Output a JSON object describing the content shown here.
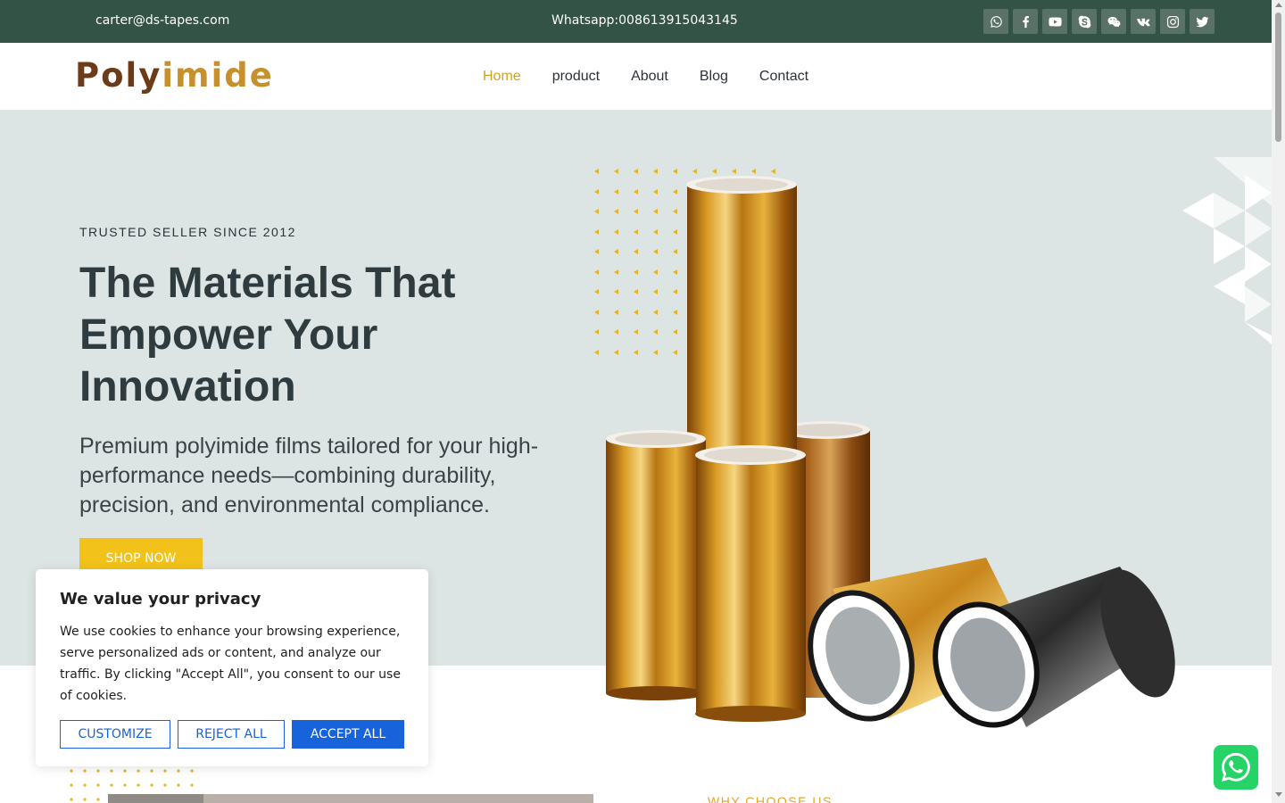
{
  "topbar": {
    "email": "carter@ds-tapes.com",
    "whatsapp": "Whatsapp:008613915043145",
    "socials": [
      {
        "icon": "whatsapp-icon"
      },
      {
        "icon": "facebook-icon"
      },
      {
        "icon": "youtube-icon"
      },
      {
        "icon": "skype-icon"
      },
      {
        "icon": "wechat-icon"
      },
      {
        "icon": "vk-icon"
      },
      {
        "icon": "instagram-icon"
      },
      {
        "icon": "twitter-icon"
      }
    ]
  },
  "header": {
    "logo_part1": "Poly",
    "logo_part2": "imide",
    "nav": [
      {
        "label": "Home",
        "active": true
      },
      {
        "label": "product"
      },
      {
        "label": "About"
      },
      {
        "label": "Blog"
      },
      {
        "label": "Contact"
      }
    ]
  },
  "hero": {
    "eyebrow": "TRUSTED SELLER SINCE 2012",
    "title": "The Materials That Empower Your Innovation",
    "subtitle": "Premium polyimide films tailored for your high-performance needs—combining durability, precision, and environmental compliance.",
    "cta": "SHOP NOW"
  },
  "cookie": {
    "title": "We value your privacy",
    "body": "We use cookies to enhance your browsing experience, serve personalized ads or content, and analyze our traffic. By clicking \"Accept All\", you consent to our use of cookies.",
    "customize": "CUSTOMIZE",
    "reject": "REJECT ALL",
    "accept": "ACCEPT ALL"
  },
  "lower": {
    "why": "WHY CHOOSE US"
  },
  "colors": {
    "topbar": "#345347",
    "accent": "#f2c21a",
    "hero_bg": "#dde5e4",
    "cookie_blue": "#1863dc",
    "whatsapp_green": "#25d366"
  }
}
